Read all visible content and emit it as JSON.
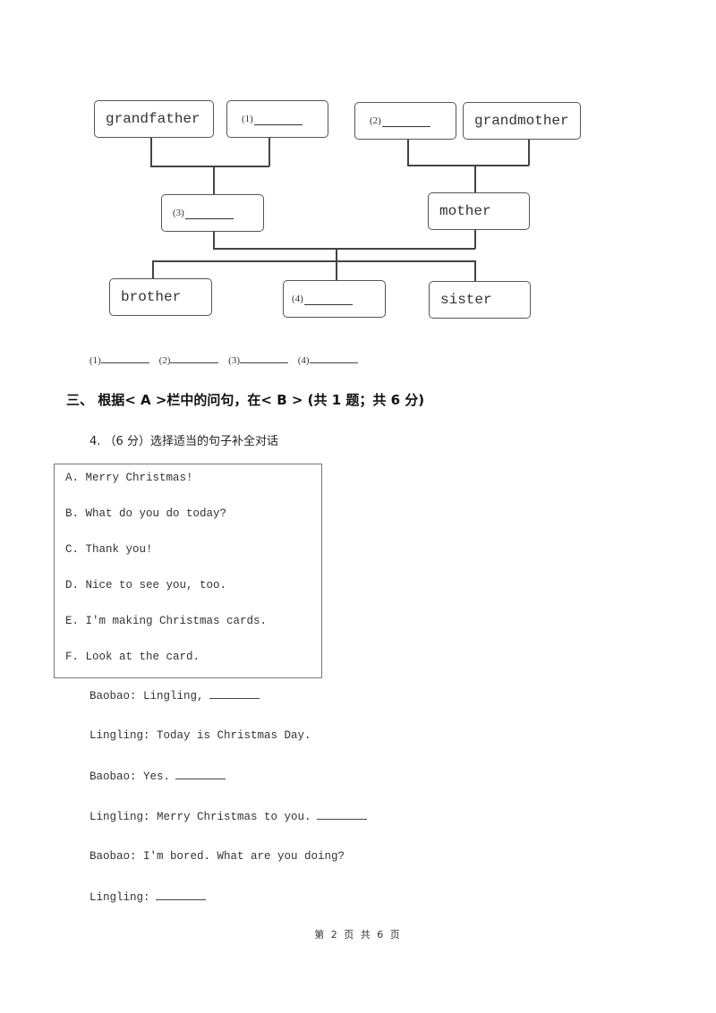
{
  "diagram": {
    "nodes": {
      "grandfather": "grandfather",
      "blank1_label": "(1)",
      "blank2_label": "(2)",
      "grandmother": "grandmother",
      "blank3_label": "(3)",
      "mother": "mother",
      "brother": "brother",
      "blank4_label": "(4)",
      "sister": "sister"
    }
  },
  "answer_blanks": [
    "(1)",
    "(2)",
    "(3)",
    "(4)"
  ],
  "section3": {
    "title": "三、 根据< A >栏中的问句，在< B > (共 1 题；共 6 分)"
  },
  "question4": {
    "title": "4. （6 分）选择适当的句子补全对话",
    "options": [
      "A. Merry Christmas!",
      "B. What do you do today?",
      "C. Thank you!",
      "D. Nice to see you, too.",
      "E. I'm making Christmas cards.",
      "F. Look at the card."
    ],
    "dialogue": [
      {
        "text": "Baobao: Lingling,",
        "blank": true
      },
      {
        "text": "Lingling: Today is Christmas Day.",
        "blank": false
      },
      {
        "text": "Baobao: Yes.",
        "blank": true
      },
      {
        "text": "Lingling: Merry Christmas to you.",
        "blank": true
      },
      {
        "text": "Baobao: I'm bored. What are you doing?",
        "blank": false
      },
      {
        "text": "Lingling:",
        "blank": true
      }
    ]
  },
  "footer": "第 2 页 共 6 页"
}
